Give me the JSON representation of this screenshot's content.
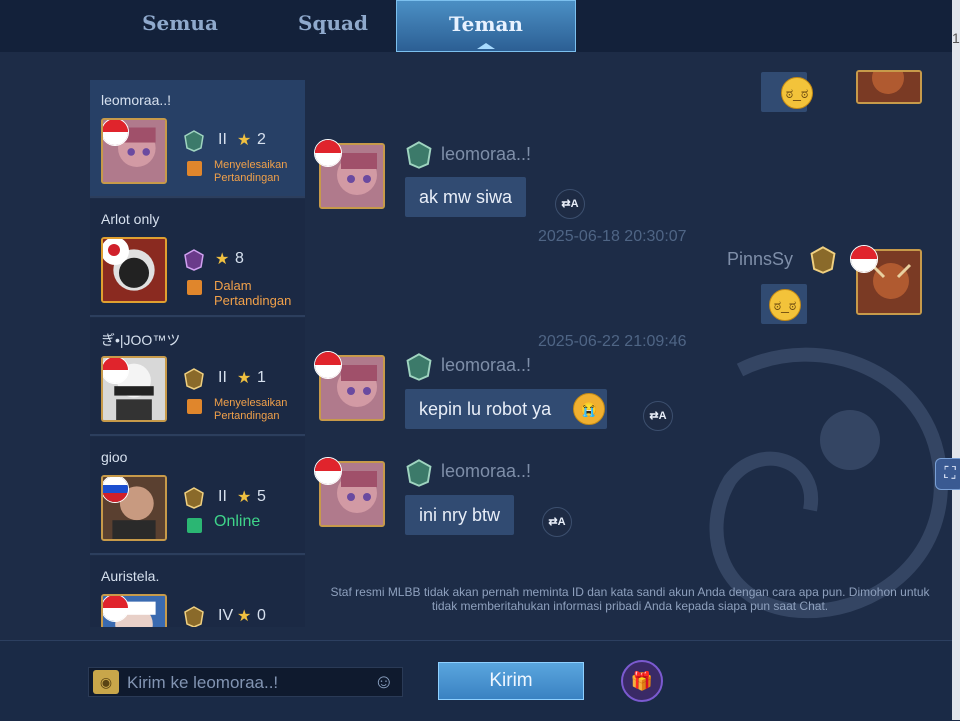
{
  "tabs": [
    {
      "label": "Semua",
      "active": false
    },
    {
      "label": "Squad",
      "active": false
    },
    {
      "label": "Teman",
      "active": true
    }
  ],
  "friends": [
    {
      "name": "leomoraa..!",
      "rank": "II",
      "stars": "2",
      "status": "Menyelesaikan Pertandingan"
    },
    {
      "name": "Arlot only",
      "rank": "",
      "stars": "8",
      "status": "Dalam Pertandingan"
    },
    {
      "name": "ぎ•|JOO™ツ",
      "rank": "II",
      "stars": "1",
      "status": "Menyelesaikan Pertandingan"
    },
    {
      "name": "gioo",
      "rank": "II",
      "stars": "5",
      "status": "Online"
    },
    {
      "name": "Auristela.",
      "rank": "IV",
      "stars": "0",
      "status": ""
    }
  ],
  "chat": {
    "messages": [
      {
        "sender": "leomoraa..!",
        "text": "ak mw siwa"
      },
      {
        "sender": "leomoraa..!",
        "text": "kepin lu robot ya"
      },
      {
        "sender": "leomoraa..!",
        "text": "ini nry btw"
      }
    ],
    "self_name": "PinnsSy",
    "timestamps": [
      "2025-06-18 20:30:07",
      "2025-06-22 21:09:46"
    ],
    "notice": "Staf resmi MLBB tidak akan pernah meminta ID dan kata sandi akun Anda dengan cara apa pun. Dimohon untuk tidak memberitahukan informasi pribadi Anda kepada siapa pun saat Chat."
  },
  "composer": {
    "placeholder": "Kirim ke leomoraa..!",
    "send_label": "Kirim"
  },
  "colors": {
    "accent": "#4b8fc4",
    "bubble": "#314b72",
    "status_orange": "#f0a04a",
    "online_green": "#3fd48a"
  },
  "icons": [
    "rank-badge-icon",
    "star-icon",
    "translate-icon",
    "emoji-icon",
    "voice-icon",
    "gift-icon",
    "screenshot-icon"
  ]
}
